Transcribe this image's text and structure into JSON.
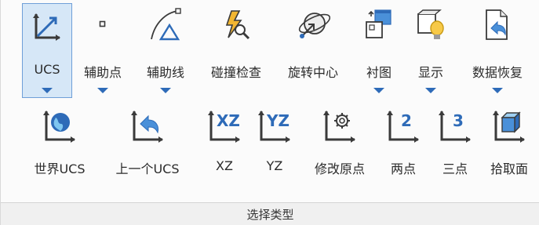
{
  "row1": {
    "tools": [
      {
        "label": "UCS",
        "icon": "ucs-axes-icon",
        "dropdown": true,
        "selected": true
      },
      {
        "label": "辅助点",
        "icon": "point-icon",
        "dropdown": true
      },
      {
        "label": "辅助线",
        "icon": "curve-line-icon",
        "dropdown": true
      },
      {
        "label": "碰撞检查",
        "icon": "collision-check-icon",
        "dropdown": false
      },
      {
        "label": "旋转中心",
        "icon": "rotation-center-icon",
        "dropdown": false
      },
      {
        "label": "衬图",
        "icon": "underlay-icon",
        "dropdown": true
      },
      {
        "label": "显示",
        "icon": "display-icon",
        "dropdown": true
      },
      {
        "label": "数据恢复",
        "icon": "data-restore-icon",
        "dropdown": true
      }
    ]
  },
  "row2": {
    "tools": [
      {
        "label": "世界UCS",
        "icon": "world-ucs-icon",
        "axis_text": ""
      },
      {
        "label": "上一个UCS",
        "icon": "previous-ucs-icon",
        "axis_text": ""
      },
      {
        "label": "XZ",
        "icon": "xz-plane-icon",
        "axis_text": "XZ"
      },
      {
        "label": "YZ",
        "icon": "yz-plane-icon",
        "axis_text": "YZ"
      },
      {
        "label": "修改原点",
        "icon": "modify-origin-icon",
        "axis_text": ""
      },
      {
        "label": "两点",
        "icon": "two-point-icon",
        "axis_text": "2"
      },
      {
        "label": "三点",
        "icon": "three-point-icon",
        "axis_text": "3"
      },
      {
        "label": "拾取面",
        "icon": "pick-face-icon",
        "axis_text": ""
      }
    ]
  },
  "footer": {
    "label": "选择类型"
  },
  "colors": {
    "accent": "#2e6bb8",
    "selected_bg": "#d6e7f7",
    "icon_dark": "#3a3a3a"
  }
}
